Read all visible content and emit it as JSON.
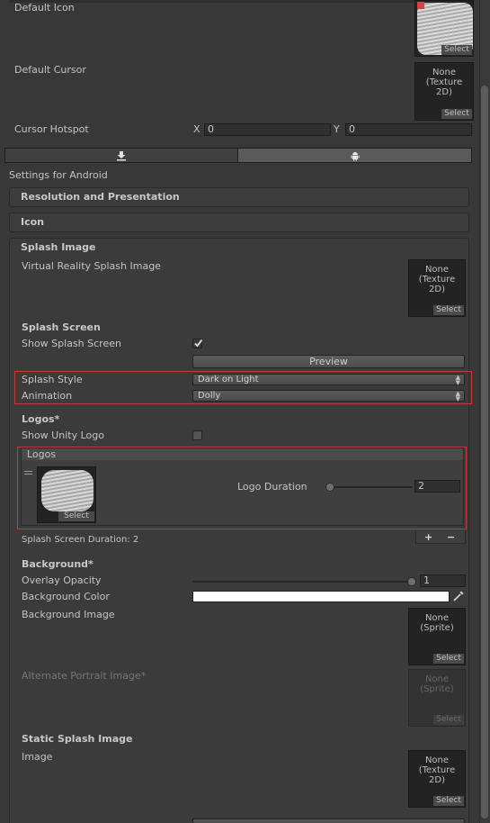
{
  "header": {
    "default_icon_label": "Default Icon",
    "default_cursor_label": "Default Cursor",
    "cursor_hotspot_label": "Cursor Hotspot",
    "hotspot_x_label": "X",
    "hotspot_x_value": "0",
    "hotspot_y_label": "Y",
    "hotspot_y_value": "0",
    "cursor_slot": {
      "line1": "None",
      "line2": "(Texture",
      "line3": "2D)",
      "select": "Select"
    },
    "icon_slot": {
      "select": "Select"
    }
  },
  "platform_tabs": [
    {
      "name": "standalone",
      "icon": "download-icon"
    },
    {
      "name": "android",
      "icon": "android-icon"
    }
  ],
  "settings_title": "Settings for Android",
  "sections": {
    "resolution": "Resolution and Presentation",
    "icon": "Icon",
    "splash_image": "Splash Image"
  },
  "splash_image": {
    "vr_label": "Virtual Reality Splash Image",
    "vr_slot": {
      "line1": "None",
      "line2": "(Texture",
      "line3": "2D)",
      "select": "Select"
    }
  },
  "splash_screen": {
    "heading": "Splash Screen",
    "show_label": "Show Splash Screen",
    "show_checked": true,
    "preview_label": "Preview",
    "style_label": "Splash Style",
    "style_value": "Dark on Light",
    "animation_label": "Animation",
    "animation_value": "Dolly"
  },
  "logos": {
    "heading": "Logos*",
    "show_unity_label": "Show Unity Logo",
    "show_unity_checked": false,
    "list_header": "Logos",
    "logo_select": "Select",
    "duration_label": "Logo Duration",
    "duration_value": "2",
    "duration_fraction": 0.0,
    "add_label": "+",
    "remove_label": "−",
    "total_duration": "Splash Screen Duration: 2"
  },
  "background": {
    "heading": "Background*",
    "opacity_label": "Overlay Opacity",
    "opacity_value": "1",
    "opacity_fraction": 1.0,
    "color_label": "Background Color",
    "color_value": "#ffffff",
    "image_label": "Background Image",
    "image_slot": {
      "line1": "None",
      "line2": "(Sprite)",
      "select": "Select"
    },
    "alt_label": "Alternate Portrait Image*",
    "alt_slot": {
      "line1": "None",
      "line2": "(Sprite)",
      "select": "Select"
    }
  },
  "static_splash": {
    "heading": "Static Splash Image",
    "image_label": "Image",
    "image_slot": {
      "line1": "None",
      "line2": "(Texture",
      "line3": "2D)",
      "select": "Select"
    }
  },
  "colors": {
    "background": "#383838",
    "highlight_box": "#c23a3a",
    "selected_tab": "#5a5a5a"
  }
}
